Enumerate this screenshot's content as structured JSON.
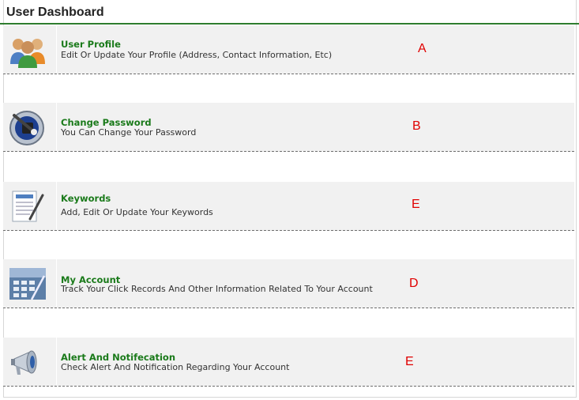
{
  "header": {
    "title": "User Dashboard"
  },
  "items": [
    {
      "title": "User Profile",
      "description": "Edit Or Update Your Profile (Address, Contact Information, Etc)",
      "marker": "A",
      "icon": "users-icon"
    },
    {
      "title": "Change Password",
      "description": "You Can Change Your Password",
      "marker": "B",
      "icon": "lock-icon"
    },
    {
      "title": "Keywords",
      "description": "Add, Edit Or Update Your Keywords",
      "marker": "E",
      "icon": "document-pencil-icon"
    },
    {
      "title": "My Account",
      "description": "Track Your Click Records And Other Information Related To Your Account",
      "marker": "D",
      "icon": "calculator-icon"
    },
    {
      "title": "Alert And Notifecation",
      "description": "Check Alert And Notification Regarding Your Account",
      "marker": "E",
      "icon": "megaphone-icon"
    }
  ],
  "colors": {
    "accent": "#2f7d2f",
    "title_link": "#1a7a1a",
    "marker": "#e00000",
    "row_bg": "#f1f1f1"
  }
}
